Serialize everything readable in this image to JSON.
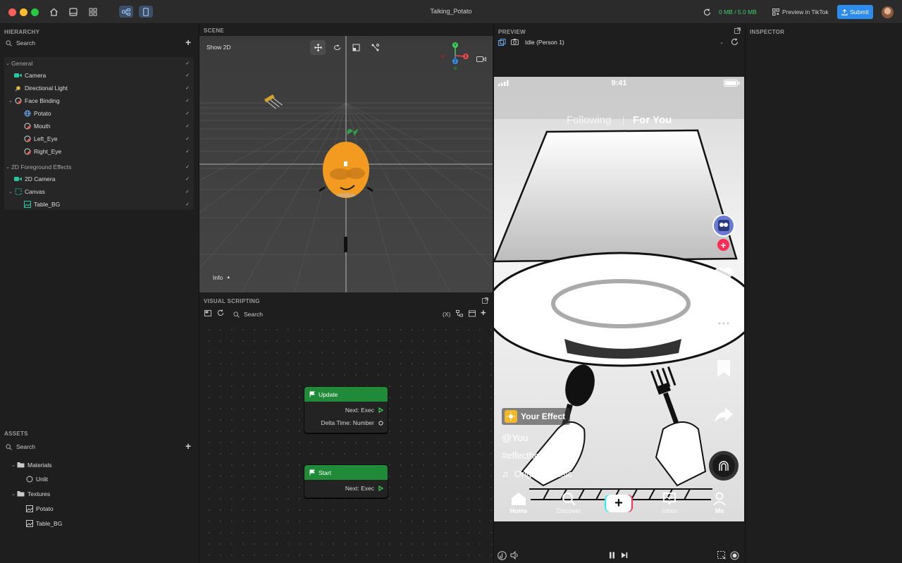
{
  "titlebar": {
    "project_title": "Talking_Potato",
    "memory": "0 MB / 5.0 MB",
    "preview_tiktok_label": "Preview in TikTok",
    "submit_label": "Submit"
  },
  "hierarchy": {
    "header": "HIERARCHY",
    "search_placeholder": "Search",
    "groups": [
      {
        "label": "General",
        "items": [
          {
            "label": "Camera"
          },
          {
            "label": "Directional Light"
          },
          {
            "label": "Face Binding"
          },
          {
            "label": "Potato"
          },
          {
            "label": "Mouth"
          },
          {
            "label": "Left_Eye"
          },
          {
            "label": "Right_Eye"
          }
        ]
      },
      {
        "label": "2D Foreground Effects",
        "items": [
          {
            "label": "2D Camera"
          },
          {
            "label": "Canvas"
          },
          {
            "label": "Table_BG"
          }
        ]
      }
    ]
  },
  "assets": {
    "header": "ASSETS",
    "search_placeholder": "Search",
    "items": [
      {
        "label": "Materials"
      },
      {
        "label": "Unlit"
      },
      {
        "label": "Textures"
      },
      {
        "label": "Potato"
      },
      {
        "label": "Table_BG"
      }
    ]
  },
  "scene": {
    "header": "SCENE",
    "show_2d_label": "Show 2D",
    "info_label": "Info",
    "gizmo": {
      "y": "Y",
      "x": "X",
      "z": "Z"
    }
  },
  "visual_scripting": {
    "header": "VISUAL SCRIPTING",
    "search_placeholder": "Search",
    "variables_label": "(X)",
    "nodes": [
      {
        "title": "Update",
        "pins": [
          "Next: Exec",
          "Delta Time: Number"
        ]
      },
      {
        "title": "Start",
        "pins": [
          "Next: Exec"
        ]
      }
    ]
  },
  "preview": {
    "header": "PREVIEW",
    "state_select": "Idle (Person 1)",
    "phone": {
      "time": "9:41",
      "tab_following": "Following",
      "tab_for_you": "For You",
      "effect_label": "Your Effect",
      "username": "@You",
      "hashtag": "#effecthouse",
      "music": "Original Music",
      "nav": [
        "Home",
        "Discover",
        "Inbox",
        "Me"
      ]
    }
  },
  "inspector": {
    "header": "INSPECTOR"
  },
  "colors": {
    "accent_blue": "#2d8ceb",
    "memory_green": "#3fcf6e",
    "node_green": "#1f8a37"
  }
}
